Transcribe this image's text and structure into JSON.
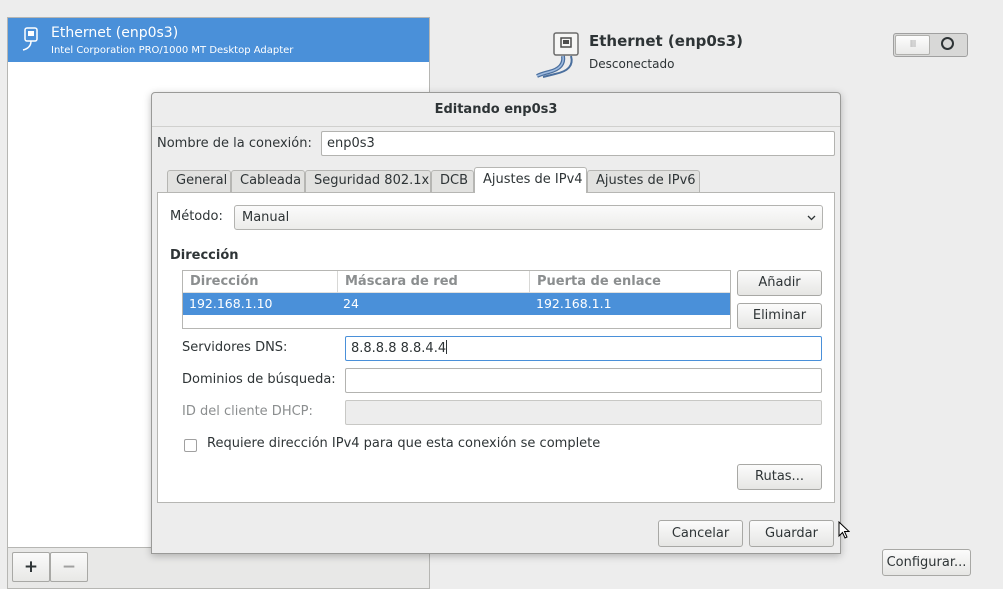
{
  "connections": {
    "items": [
      {
        "name": "Ethernet (enp0s3)",
        "subtitle": "Intel Corporation PRO/1000 MT Desktop Adapter"
      }
    ],
    "add_label": "+",
    "remove_label": "−"
  },
  "device": {
    "title": "Ethernet (enp0s3)",
    "status": "Desconectado",
    "toggle_on_label": "III",
    "configure_label": "Configurar..."
  },
  "dialog": {
    "title": "Editando enp0s3",
    "connection_name_label": "Nombre de la conexión:",
    "connection_name_value": "enp0s3",
    "tabs": [
      {
        "label": "General"
      },
      {
        "label": "Cableada"
      },
      {
        "label": "Seguridad 802.1x"
      },
      {
        "label": "DCB"
      },
      {
        "label": "Ajustes de IPv4"
      },
      {
        "label": "Ajustes de IPv6"
      }
    ],
    "active_tab": "Ajustes de IPv4",
    "ipv4": {
      "method_label": "Método:",
      "method_value": "Manual",
      "address_section_label": "Dirección",
      "table": {
        "columns": [
          "Dirección",
          "Máscara de red",
          "Puerta de enlace"
        ],
        "rows": [
          {
            "address": "192.168.1.10",
            "netmask": "24",
            "gateway": "192.168.1.1"
          }
        ]
      },
      "add_label": "Añadir",
      "delete_label": "Eliminar",
      "dns_label": "Servidores DNS:",
      "dns_value": "8.8.8.8 8.8.4.4",
      "search_domains_label": "Dominios de búsqueda:",
      "search_domains_value": "",
      "dhcp_client_id_label": "ID del cliente DHCP:",
      "dhcp_client_id_value": "",
      "require_ipv4_label": "Requiere dirección IPv4 para que esta conexión se complete",
      "require_ipv4_checked": false,
      "routes_label": "Rutas..."
    },
    "cancel_label": "Cancelar",
    "save_label": "Guardar"
  },
  "colors": {
    "selection": "#4a90d9",
    "window_bg": "#ededed",
    "text": "#2e3436"
  }
}
